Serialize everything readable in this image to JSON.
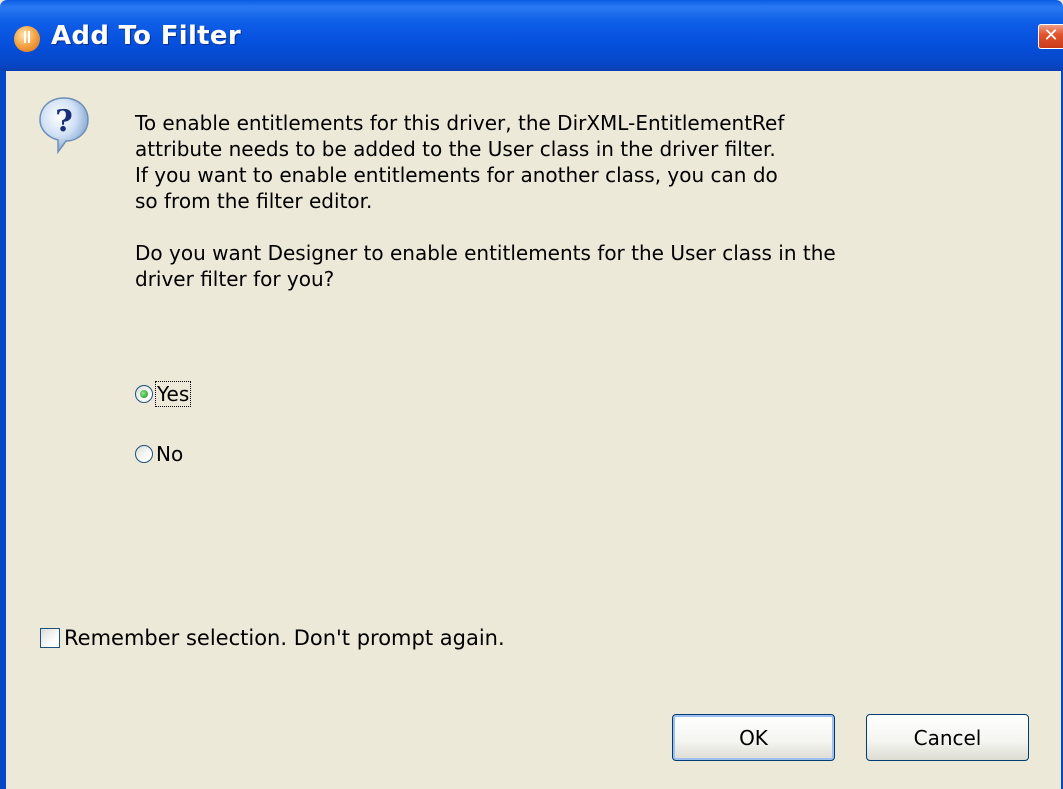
{
  "window": {
    "title": "Add To Filter",
    "close_symbol": "✕"
  },
  "icons": {
    "title_icon": "novell-designer-icon",
    "message_icon": "question-icon",
    "close_icon": "close-icon"
  },
  "message": {
    "paragraph1": "To enable entitlements for this driver, the DirXML-EntitlementRef\nattribute needs to be added to the User class in the driver filter.\nIf you want to enable entitlements for another class, you can do\nso from the filter editor.",
    "paragraph2": "Do you want Designer to enable entitlements for the User class in the\ndriver filter for you?"
  },
  "options": {
    "yes_label": "Yes",
    "no_label": "No",
    "selected": "Yes"
  },
  "remember": {
    "label": "Remember selection. Don't prompt again.",
    "checked": false
  },
  "buttons": {
    "ok_label": "OK",
    "cancel_label": "Cancel"
  },
  "colors": {
    "titlebar": "#0a5be4",
    "dialog_bg": "#ece9d8",
    "close_button": "#e2552f"
  }
}
